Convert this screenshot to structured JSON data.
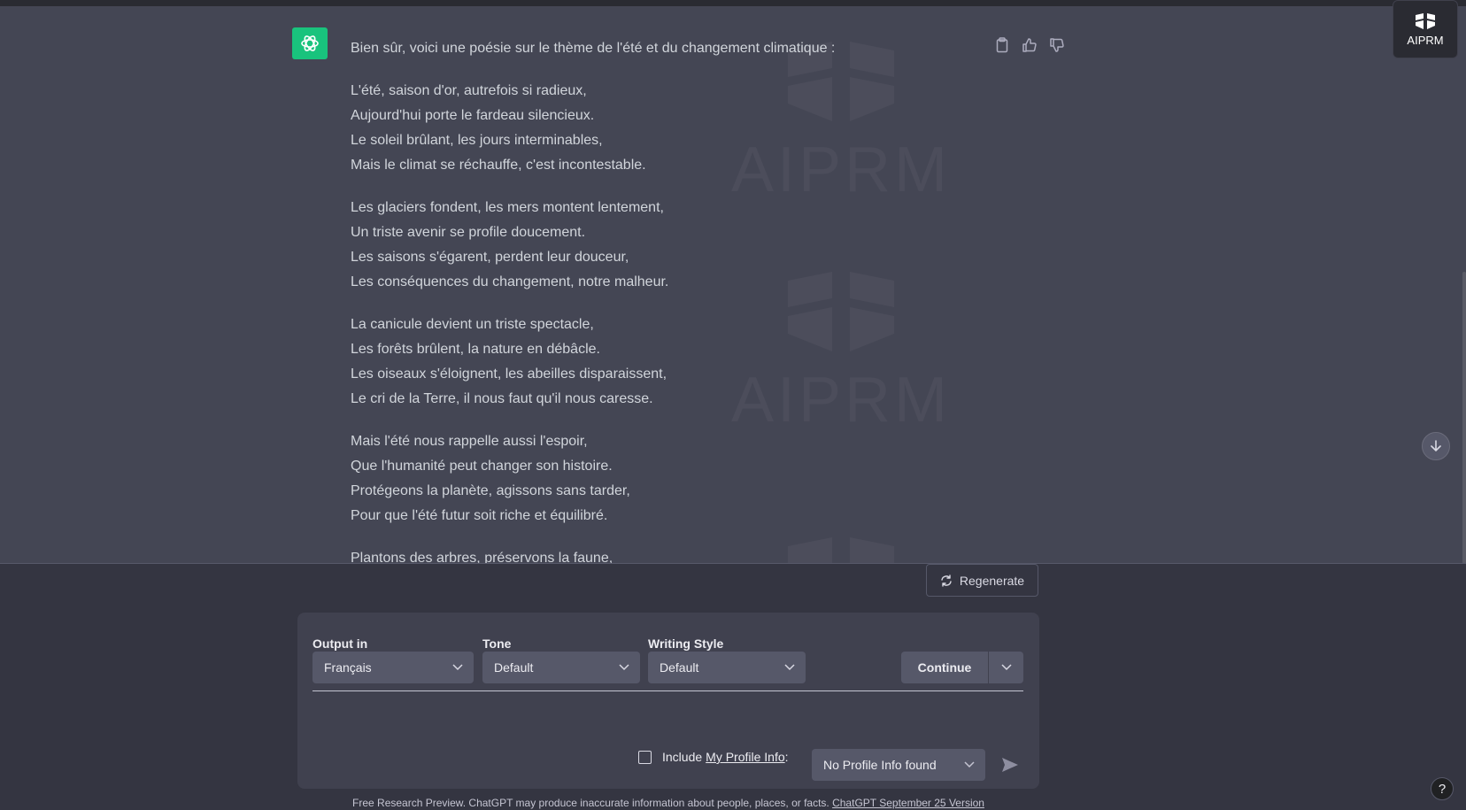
{
  "message": {
    "intro": "Bien sûr, voici une poésie sur le thème de l'été et du changement climatique :",
    "stanzas": [
      [
        "L'été, saison d'or, autrefois si radieux,",
        "Aujourd'hui porte le fardeau silencieux.",
        "Le soleil brûlant, les jours interminables,",
        "Mais le climat se réchauffe, c'est incontestable."
      ],
      [
        "Les glaciers fondent, les mers montent lentement,",
        "Un triste avenir se profile doucement.",
        "Les saisons s'égarent, perdent leur douceur,",
        "Les conséquences du changement, notre malheur."
      ],
      [
        "La canicule devient un triste spectacle,",
        "Les forêts brûlent, la nature en débâcle.",
        "Les oiseaux s'éloignent, les abeilles disparaissent,",
        "Le cri de la Terre, il nous faut qu'il nous caresse."
      ],
      [
        "Mais l'été nous rappelle aussi l'espoir,",
        "Que l'humanité peut changer son histoire.",
        "Protégeons la planète, agissons sans tarder,",
        "Pour que l'été futur soit riche et équilibré."
      ],
      [
        "Plantons des arbres, préservons la faune,"
      ]
    ]
  },
  "watermark_text": "AIPRM",
  "aiprm_badge": "AIPRM",
  "regenerate_label": "Regenerate",
  "panel": {
    "output_label": "Output in",
    "output_value": "Français",
    "tone_label": "Tone",
    "tone_value": "Default",
    "style_label": "Writing Style",
    "style_value": "Default",
    "continue_label": "Continue",
    "include_label": "Include",
    "profile_link": "My Profile Info",
    "profile_colon": ":",
    "profile_select": "No Profile Info found"
  },
  "footer": {
    "text": "Free Research Preview. ChatGPT may produce inaccurate information about people, places, or facts.",
    "version_link": "ChatGPT September 25 Version"
  },
  "help_label": "?",
  "colors": {
    "accent": "#19c37d",
    "message_bg": "#444654",
    "page_bg": "#343541",
    "panel_bg": "#40414f"
  }
}
